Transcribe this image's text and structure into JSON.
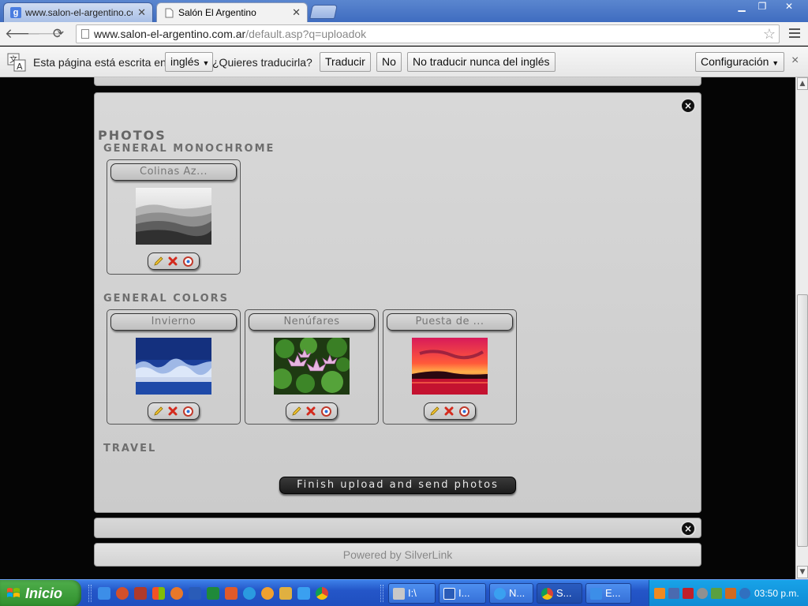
{
  "browser": {
    "tabs": [
      {
        "label": "www.salon-el-argentino.com",
        "active": false
      },
      {
        "label": "Salón El Argentino",
        "active": true
      }
    ],
    "url_host": "www.salon-el-argentino.com.ar",
    "url_path": "/default.asp?q=uploadok"
  },
  "translate_bar": {
    "text_before": "Esta página está escrita en",
    "language": "inglés",
    "question": "¿Quieres traducirla?",
    "translate_label": "Traducir",
    "no_label": "No",
    "never_label": "No traducir nunca del inglés",
    "settings_label": "Configuración",
    "close_glyph": "×"
  },
  "page": {
    "section_title": "PHOTOS",
    "categories": [
      {
        "title": "GENERAL MONOCHROME",
        "photos": [
          {
            "name": "Colinas Az...",
            "image": "misty-hills-grayscale"
          }
        ]
      },
      {
        "title": "GENERAL COLORS",
        "photos": [
          {
            "name": "Invierno",
            "image": "winter-blue-trees"
          },
          {
            "name": "Nenúfares",
            "image": "water-lilies"
          },
          {
            "name": "Puesta de ...",
            "image": "red-sunset"
          }
        ]
      },
      {
        "title": "TRAVEL",
        "photos": []
      }
    ],
    "action_icons": [
      "edit-pencil-icon",
      "delete-x-icon",
      "rotate-icon"
    ],
    "finish_button": "Finish upload and send photos",
    "close_glyph": "×",
    "footer": "Powered by SilverLink"
  },
  "taskbar": {
    "start_label": "Inicio",
    "tasks": [
      {
        "label": "I:\\",
        "active": false
      },
      {
        "label": "I...",
        "active": false
      },
      {
        "label": "N...",
        "active": false
      },
      {
        "label": "S...",
        "active": true
      },
      {
        "label": "E...",
        "active": false
      }
    ],
    "clock": "03:50 p.m."
  },
  "colors": {
    "chrome_frame": "#3f6cc0",
    "panel_gray": "#cbcbcb",
    "finish_button": "#1c1c1c",
    "taskbar_blue": "#2456c8",
    "start_green": "#3a9a36"
  }
}
